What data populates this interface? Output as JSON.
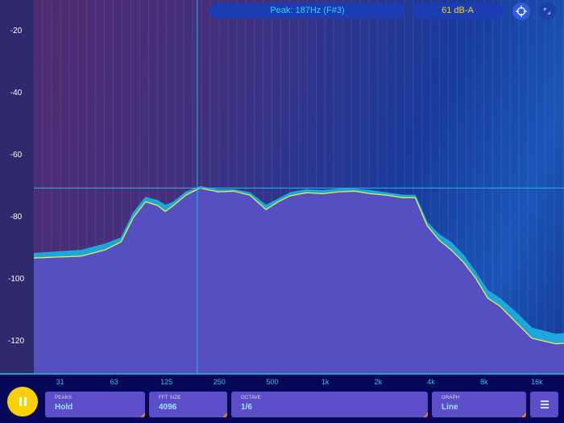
{
  "header": {
    "peak_label": "Peak: 187Hz (F#3)",
    "level_label": "61 dB-A",
    "peak_color": "#2fd4f0",
    "level_color": "#f3d21a"
  },
  "controls": [
    {
      "title": "PEAKS",
      "value": "Hold"
    },
    {
      "title": "FFT SIZE",
      "value": "4096"
    },
    {
      "title": "OCTAVE",
      "value": "1/6"
    },
    {
      "title": "GRAPH",
      "value": "Line"
    }
  ],
  "chart_data": {
    "type": "line",
    "xscale": "log",
    "xlim": [
      22,
      22800
    ],
    "ylim": [
      -130,
      -10
    ],
    "y_ticks": [
      -20,
      -40,
      -60,
      -80,
      -100,
      -120
    ],
    "y_tick_labels": [
      "-20",
      "-40",
      "-60",
      "-80",
      "-100",
      "-120"
    ],
    "x_ticks": [
      31,
      63,
      125,
      250,
      500,
      1000,
      2000,
      4000,
      8000,
      16000
    ],
    "x_tick_labels": [
      "31",
      "63",
      "125",
      "250",
      "500",
      "1k",
      "2k",
      "4k",
      "8k",
      "16k"
    ],
    "cursor": {
      "freq": 187,
      "db": -70.5
    },
    "series": [
      {
        "name": "spectrum",
        "color": "#e8f040",
        "freq": [
          22,
          41,
          56,
          69,
          81,
          95,
          111,
          123,
          137,
          161,
          194,
          245,
          302,
          373,
          460,
          540,
          632,
          780,
          963,
          1190,
          1470,
          1810,
          2240,
          2770,
          3250,
          3800,
          4450,
          5200,
          6100,
          7150,
          8400,
          9850,
          12150,
          14950,
          20500,
          22800
        ],
        "db": [
          -93,
          -92.4,
          -90.4,
          -87.8,
          -80,
          -74.9,
          -76.1,
          -78,
          -76.1,
          -72.8,
          -70.5,
          -71.7,
          -71.5,
          -72.8,
          -77.4,
          -74.9,
          -73,
          -72,
          -72.3,
          -71.7,
          -71.5,
          -72.3,
          -72.8,
          -73.6,
          -73.6,
          -82.6,
          -87.3,
          -90.4,
          -94.3,
          -99.4,
          -105.9,
          -108.5,
          -113.7,
          -118.8,
          -120.6,
          -120.4
        ]
      },
      {
        "name": "peak-hold",
        "color": "#1ab0e0",
        "freq": [
          22,
          41,
          56,
          69,
          81,
          95,
          111,
          123,
          137,
          161,
          194,
          245,
          302,
          373,
          460,
          540,
          632,
          780,
          963,
          1190,
          1470,
          1810,
          2240,
          2770,
          3250,
          3800,
          4450,
          5200,
          6100,
          7150,
          8400,
          9850,
          12150,
          14950,
          20500,
          22800
        ],
        "db": [
          -91.5,
          -90.5,
          -88.5,
          -86.5,
          -78.5,
          -73.5,
          -74.5,
          -76,
          -75,
          -71.8,
          -70,
          -71,
          -71,
          -72,
          -76,
          -74,
          -72,
          -71,
          -71.3,
          -70.8,
          -70.8,
          -71.3,
          -72,
          -72.8,
          -72.8,
          -81.5,
          -85.5,
          -88,
          -92,
          -97.5,
          -103.5,
          -106,
          -110.5,
          -115.5,
          -117.5,
          -117.3
        ]
      }
    ]
  }
}
